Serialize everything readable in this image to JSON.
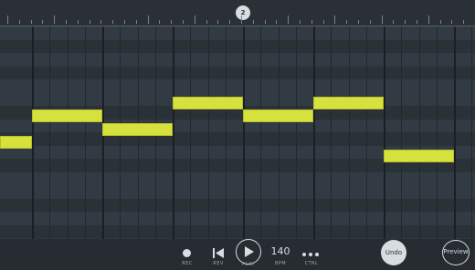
{
  "ruler": {
    "playhead_label": "2"
  },
  "grid": {
    "note_color": "#d6e13d",
    "notes": [
      {
        "start": 0.0,
        "length": 0.45,
        "row": 8
      },
      {
        "start": 0.45,
        "length": 1.0,
        "row": 6
      },
      {
        "start": 1.45,
        "length": 1.0,
        "row": 7
      },
      {
        "start": 2.45,
        "length": 1.0,
        "row": 5
      },
      {
        "start": 3.45,
        "length": 1.0,
        "row": 6
      },
      {
        "start": 4.45,
        "length": 1.0,
        "row": 5
      },
      {
        "start": 5.45,
        "length": 1.0,
        "row": 9
      }
    ]
  },
  "transport": {
    "rec_label": "REC",
    "rev_label": "REV",
    "play_label": "PLAY",
    "bpm_value": "140",
    "bpm_label": "BPM",
    "ctrl_label": "CTRL",
    "undo_label": "Undo",
    "preview_label": "Preview"
  }
}
